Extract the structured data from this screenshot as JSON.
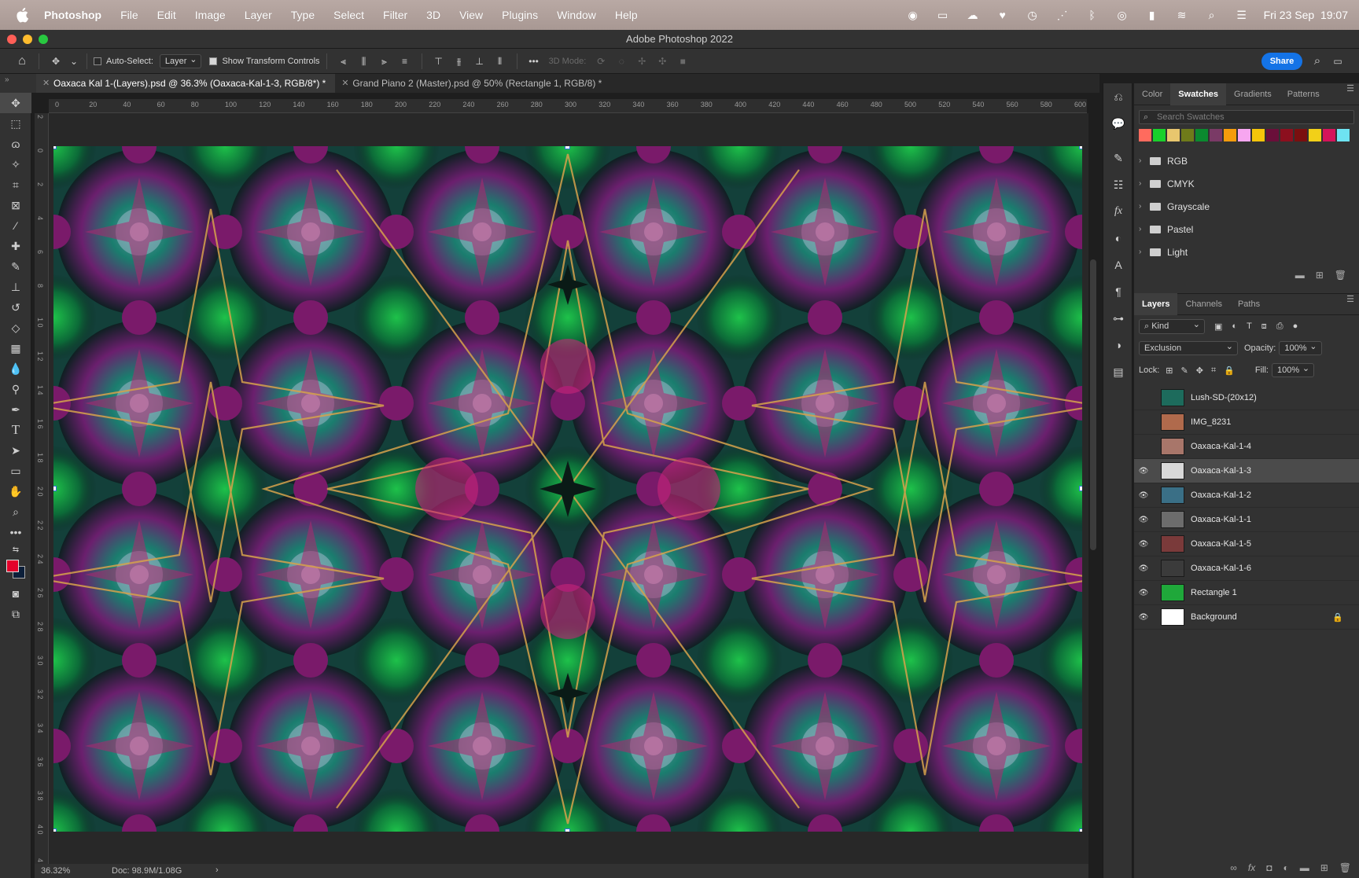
{
  "menubar": {
    "app": "Photoshop",
    "items": [
      "File",
      "Edit",
      "Image",
      "Layer",
      "Type",
      "Select",
      "Filter",
      "3D",
      "View",
      "Plugins",
      "Window",
      "Help"
    ],
    "clock": "Fri 23 Sep  19:07"
  },
  "window": {
    "title": "Adobe Photoshop 2022"
  },
  "options": {
    "auto_select_label": "Auto-Select:",
    "auto_select_value": "Layer",
    "transform_label": "Show Transform Controls",
    "mode_3d": "3D Mode:",
    "share": "Share"
  },
  "tabs": [
    {
      "label": "Oaxaca Kal 1-(Layers).psd @ 36.3% (Oaxaca-Kal-1-3, RGB/8*) *"
    },
    {
      "label": "Grand Piano 2 (Master).psd @ 50% (Rectangle 1, RGB/8) *"
    }
  ],
  "ruler_h": [
    "0",
    "20",
    "40",
    "60",
    "80",
    "100",
    "120",
    "140",
    "160",
    "180",
    "200",
    "220",
    "240",
    "260",
    "280",
    "300",
    "320",
    "340",
    "360",
    "380",
    "400",
    "420",
    "440",
    "460",
    "480",
    "500",
    "520",
    "540",
    "560",
    "580",
    "600"
  ],
  "ruler_v": [
    "2",
    "0",
    "2",
    "4",
    "6",
    "8",
    "1 0",
    "1 2",
    "1 4",
    "1 6",
    "1 8",
    "2 0",
    "2 2",
    "2 4",
    "2 6",
    "2 8",
    "3 0",
    "3 2",
    "3 4",
    "3 6",
    "3 8",
    "4 0",
    "4"
  ],
  "status": {
    "zoom": "36.32%",
    "doc": "Doc: 98.9M/1.08G"
  },
  "swatches_panel": {
    "tabs": [
      "Color",
      "Swatches",
      "Gradients",
      "Patterns"
    ],
    "active_tab": "Swatches",
    "search_placeholder": "Search Swatches",
    "colors": [
      "#ff6b5e",
      "#19d02b",
      "#e8c66e",
      "#6f7b1a",
      "#0a8a2f",
      "#7a3a66",
      "#f59c0c",
      "#f7a6f0",
      "#f5c50a",
      "#6a0f3a",
      "#8c0f1e",
      "#7a0f0f",
      "#f2d018",
      "#d4145a",
      "#6ee3f2"
    ],
    "groups": [
      "RGB",
      "CMYK",
      "Grayscale",
      "Pastel",
      "Light"
    ]
  },
  "layers_panel": {
    "tabs": [
      "Layers",
      "Channels",
      "Paths"
    ],
    "active_tab": "Layers",
    "filter": "Kind",
    "blend_mode": "Exclusion",
    "opacity_label": "Opacity:",
    "opacity": "100%",
    "lock_label": "Lock:",
    "fill_label": "Fill:",
    "fill": "100%",
    "layers": [
      {
        "name": "Lush-SD-(20x12)",
        "visible": false,
        "thumb": "#1d6b5c"
      },
      {
        "name": "IMG_8231",
        "visible": false,
        "thumb": "#b06a4c"
      },
      {
        "name": "Oaxaca-Kal-1-4",
        "visible": false,
        "thumb": "#a8766a"
      },
      {
        "name": "Oaxaca-Kal-1-3",
        "visible": true,
        "thumb": "#d8d8d8",
        "selected": true
      },
      {
        "name": "Oaxaca-Kal-1-2",
        "visible": true,
        "thumb": "#3a6f86"
      },
      {
        "name": "Oaxaca-Kal-1-1",
        "visible": true,
        "thumb": "#6c6c6c"
      },
      {
        "name": "Oaxaca-Kal-1-5",
        "visible": true,
        "thumb": "#7a3a3a"
      },
      {
        "name": "Oaxaca-Kal-1-6",
        "visible": true,
        "thumb": "#3b3b3b"
      },
      {
        "name": "Rectangle 1",
        "visible": true,
        "thumb": "#1fa83a"
      },
      {
        "name": "Background",
        "visible": true,
        "thumb": "#ffffff",
        "locked": true
      }
    ]
  }
}
